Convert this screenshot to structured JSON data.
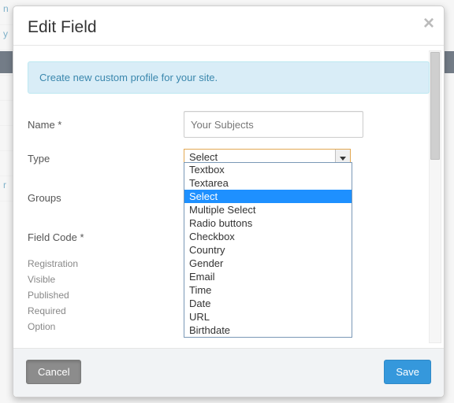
{
  "modal": {
    "title": "Edit Field",
    "info": "Create new custom profile for your site.",
    "labels": {
      "name": "Name *",
      "type": "Type",
      "groups": "Groups",
      "field_code": "Field Code *",
      "registration": "Registration",
      "visible": "Visible",
      "published": "Published",
      "required": "Required",
      "option": "Option"
    },
    "name_value": "Your Subjects",
    "type_value": "Select",
    "type_options": [
      "Textbox",
      "Textarea",
      "Select",
      "Multiple Select",
      "Radio buttons",
      "Checkbox",
      "Country",
      "Gender",
      "Email",
      "Time",
      "Date",
      "URL",
      "Birthdate"
    ],
    "type_selected_index": 2,
    "buttons": {
      "cancel": "Cancel",
      "save": "Save"
    }
  },
  "bg_left": [
    "n",
    "y",
    "r"
  ]
}
